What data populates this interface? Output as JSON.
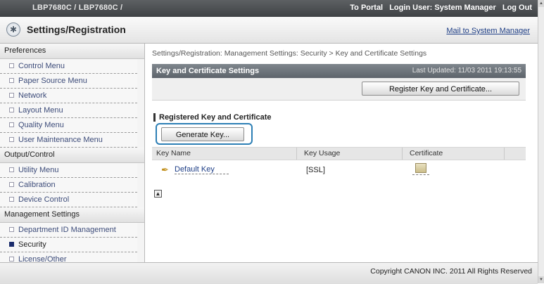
{
  "topbar": {
    "device": "LBP7680C / LBP7680C /",
    "portal": "To Portal",
    "login_user": "Login User: System Manager",
    "logout": "Log Out"
  },
  "header": {
    "title": "Settings/Registration",
    "mail_link": "Mail to System Manager",
    "icon": "settings-gear-icon"
  },
  "sidebar": {
    "sections": [
      {
        "label": "Preferences",
        "items": [
          "Control Menu",
          "Paper Source Menu",
          "Network",
          "Layout Menu",
          "Quality Menu",
          "User Maintenance Menu"
        ]
      },
      {
        "label": "Output/Control",
        "items": [
          "Utility Menu",
          "Calibration",
          "Device Control"
        ]
      },
      {
        "label": "Management Settings",
        "items": [
          "Department ID Management",
          "Security",
          "License/Other"
        ]
      }
    ],
    "active_item": "Security"
  },
  "main": {
    "breadcrumb": "Settings/Registration: Management Settings: Security > Key and Certificate Settings",
    "panel_title": "Key and Certificate Settings",
    "last_updated": "Last Updated: 11/03 2011 19:13:55",
    "register_button": "Register Key and Certificate...",
    "section_title": "Registered Key and Certificate",
    "generate_button": "Generate Key...",
    "table": {
      "columns": [
        "Key Name",
        "Key Usage",
        "Certificate"
      ],
      "rows": [
        {
          "key_name": "Default Key",
          "key_usage": "[SSL]",
          "certificate_icon": "certificate-icon"
        }
      ]
    }
  },
  "footer": {
    "copyright": "Copyright CANON INC. 2011 All Rights Reserved"
  },
  "colors": {
    "topbar": "#4a4d50",
    "panel_header": "#6d747b",
    "highlight_border": "#2d7fb5",
    "link": "#1f3f86"
  }
}
